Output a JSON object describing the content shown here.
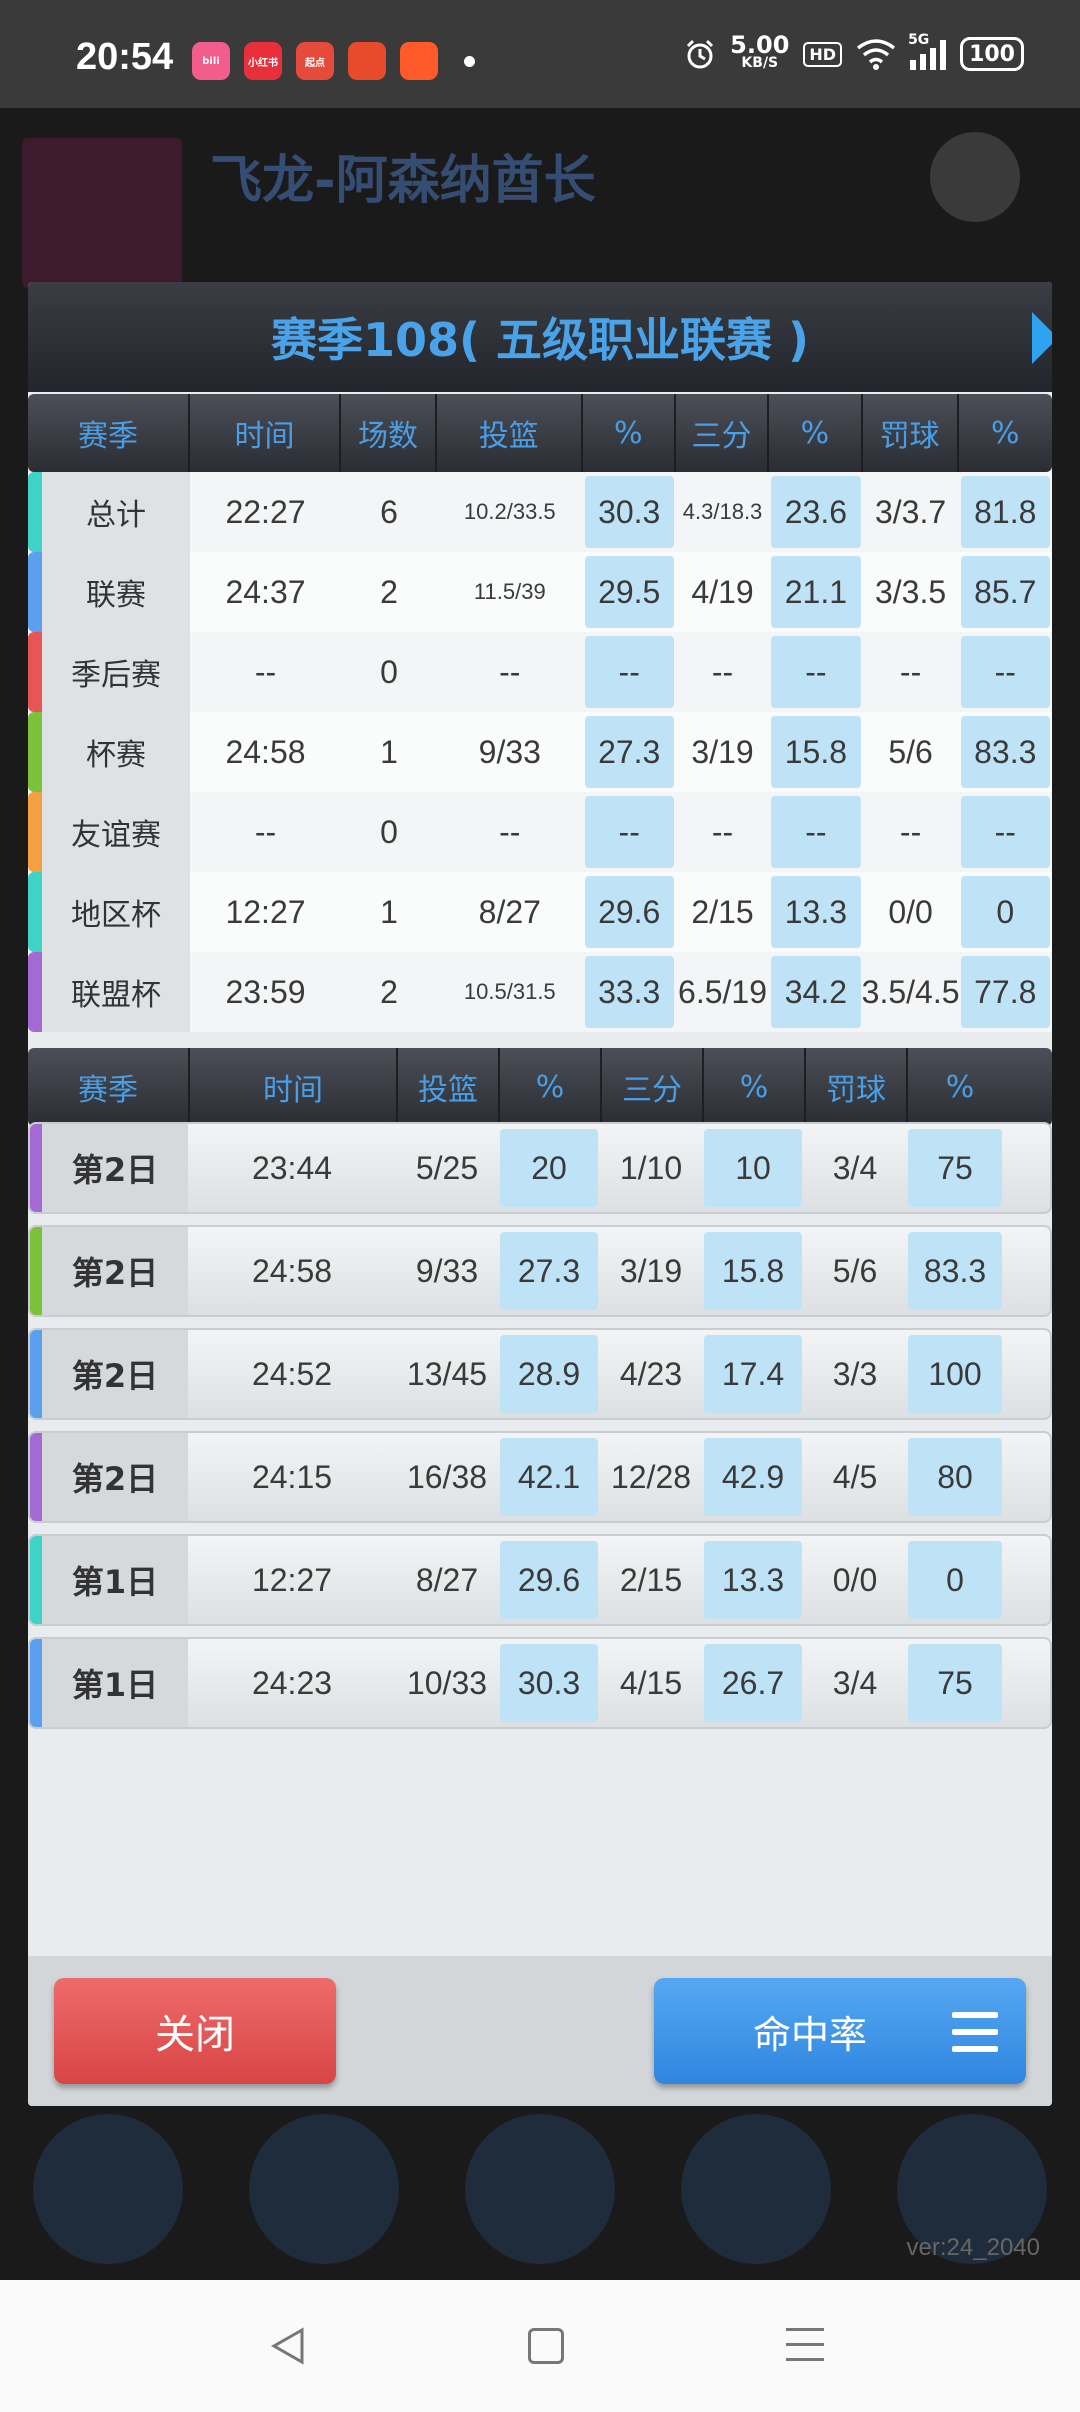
{
  "status_bar": {
    "time": "20:54",
    "apps": [
      {
        "name": "app-bilibili-icon",
        "label": "bili",
        "color": "#f25d8e"
      },
      {
        "name": "app-xiaohongshu-icon",
        "label": "小红书",
        "color": "#e8303d"
      },
      {
        "name": "app-qidian-icon",
        "label": "起点",
        "color": "#e64a3a"
      },
      {
        "name": "app-game-icon",
        "label": "",
        "color": "#e84b2c"
      },
      {
        "name": "app-kuaishou-icon",
        "label": "",
        "color": "#ff5a2a"
      }
    ],
    "speed_value": "5.00",
    "speed_unit": "KB/S",
    "hd": "HD",
    "network": "5G",
    "battery": "100"
  },
  "background": {
    "title": "飞龙-阿森纳酋长",
    "version": "ver:24_2040"
  },
  "dialog": {
    "title": "赛季108( 五级职业联赛 )",
    "summary_headers": [
      "赛季",
      "时间",
      "场数",
      "投篮",
      "%",
      "三分",
      "%",
      "罚球",
      "%"
    ],
    "summary_rows": [
      {
        "label": "总计",
        "strip": "#3fd3c8",
        "time": "22:27",
        "games": "6",
        "fg": "10.2/33.5",
        "fg_pct": "30.3",
        "three": "4.3/18.3",
        "three_pct": "23.6",
        "ft": "3/3.7",
        "ft_pct": "81.8"
      },
      {
        "label": "联赛",
        "strip": "#5aa0ee",
        "time": "24:37",
        "games": "2",
        "fg": "11.5/39",
        "fg_pct": "29.5",
        "three": "4/19",
        "three_pct": "21.1",
        "ft": "3/3.5",
        "ft_pct": "85.7"
      },
      {
        "label": "季后赛",
        "strip": "#e85555",
        "time": "--",
        "games": "0",
        "fg": "--",
        "fg_pct": "--",
        "three": "--",
        "three_pct": "--",
        "ft": "--",
        "ft_pct": "--"
      },
      {
        "label": "杯赛",
        "strip": "#7cc13a",
        "time": "24:58",
        "games": "1",
        "fg": "9/33",
        "fg_pct": "27.3",
        "three": "3/19",
        "three_pct": "15.8",
        "ft": "5/6",
        "ft_pct": "83.3"
      },
      {
        "label": "友谊赛",
        "strip": "#f5a040",
        "time": "--",
        "games": "0",
        "fg": "--",
        "fg_pct": "--",
        "three": "--",
        "three_pct": "--",
        "ft": "--",
        "ft_pct": "--"
      },
      {
        "label": "地区杯",
        "strip": "#3fd3c8",
        "time": "12:27",
        "games": "1",
        "fg": "8/27",
        "fg_pct": "29.6",
        "three": "2/15",
        "three_pct": "13.3",
        "ft": "0/0",
        "ft_pct": "0"
      },
      {
        "label": "联盟杯",
        "strip": "#a36ad6",
        "time": "23:59",
        "games": "2",
        "fg": "10.5/31.5",
        "fg_pct": "33.3",
        "three": "6.5/19",
        "three_pct": "34.2",
        "ft": "3.5/4.5",
        "ft_pct": "77.8"
      }
    ],
    "log_headers": [
      "赛季",
      "时间",
      "投篮",
      "%",
      "三分",
      "%",
      "罚球",
      "%"
    ],
    "log_rows": [
      {
        "label": "第2日",
        "strip": "#a36ad6",
        "time": "23:44",
        "fg": "5/25",
        "fg_pct": "20",
        "three": "1/10",
        "three_pct": "10",
        "ft": "3/4",
        "ft_pct": "75"
      },
      {
        "label": "第2日",
        "strip": "#7cc13a",
        "time": "24:58",
        "fg": "9/33",
        "fg_pct": "27.3",
        "three": "3/19",
        "three_pct": "15.8",
        "ft": "5/6",
        "ft_pct": "83.3"
      },
      {
        "label": "第2日",
        "strip": "#5aa0ee",
        "time": "24:52",
        "fg": "13/45",
        "fg_pct": "28.9",
        "three": "4/23",
        "three_pct": "17.4",
        "ft": "3/3",
        "ft_pct": "100"
      },
      {
        "label": "第2日",
        "strip": "#a36ad6",
        "time": "24:15",
        "fg": "16/38",
        "fg_pct": "42.1",
        "three": "12/28",
        "three_pct": "42.9",
        "ft": "4/5",
        "ft_pct": "80"
      },
      {
        "label": "第1日",
        "strip": "#3fd3c8",
        "time": "12:27",
        "fg": "8/27",
        "fg_pct": "29.6",
        "three": "2/15",
        "three_pct": "13.3",
        "ft": "0/0",
        "ft_pct": "0"
      },
      {
        "label": "第1日",
        "strip": "#5aa0ee",
        "time": "24:23",
        "fg": "10/33",
        "fg_pct": "30.3",
        "three": "4/15",
        "three_pct": "26.7",
        "ft": "3/4",
        "ft_pct": "75"
      }
    ],
    "close_label": "关闭",
    "rate_label": "命中率"
  }
}
